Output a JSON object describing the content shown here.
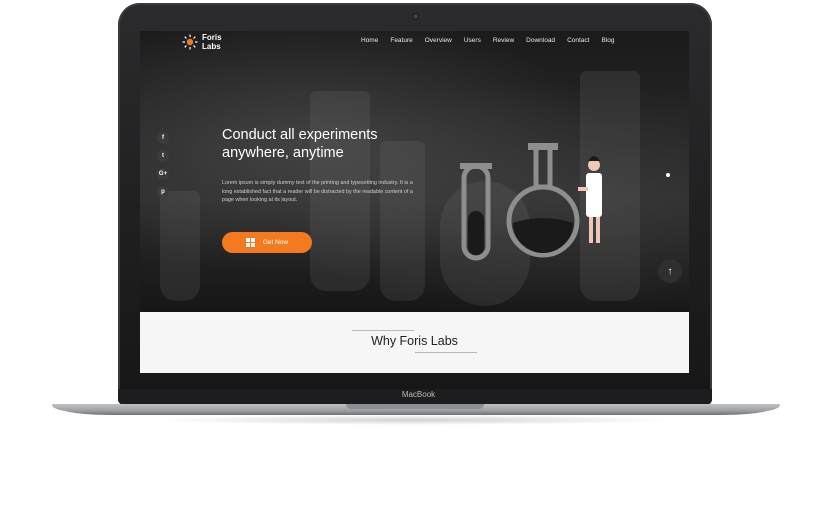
{
  "brand": {
    "name_line1": "Foris",
    "name_line2": "Labs",
    "device_label": "MacBook"
  },
  "nav": {
    "items": [
      "Home",
      "Feature",
      "Overview",
      "Users",
      "Review",
      "Download",
      "Contact",
      "Blog"
    ]
  },
  "social": [
    "f",
    "t",
    "G+",
    "p"
  ],
  "hero": {
    "headline_line1": "Conduct all experiments",
    "headline_line2": "anywhere, anytime",
    "description": "Lorem ipsum is simply dummy text of the printing and typesetting industry. It is a long established fact that a reader will be distracted by the readable content of a page when looking at its layout.",
    "cta_label": "Get Now"
  },
  "section": {
    "title": "Why Foris Labs"
  },
  "colors": {
    "accent": "#f47a20",
    "hero_bg": "#1b1b1b",
    "section_bg": "#f6f6f6"
  }
}
